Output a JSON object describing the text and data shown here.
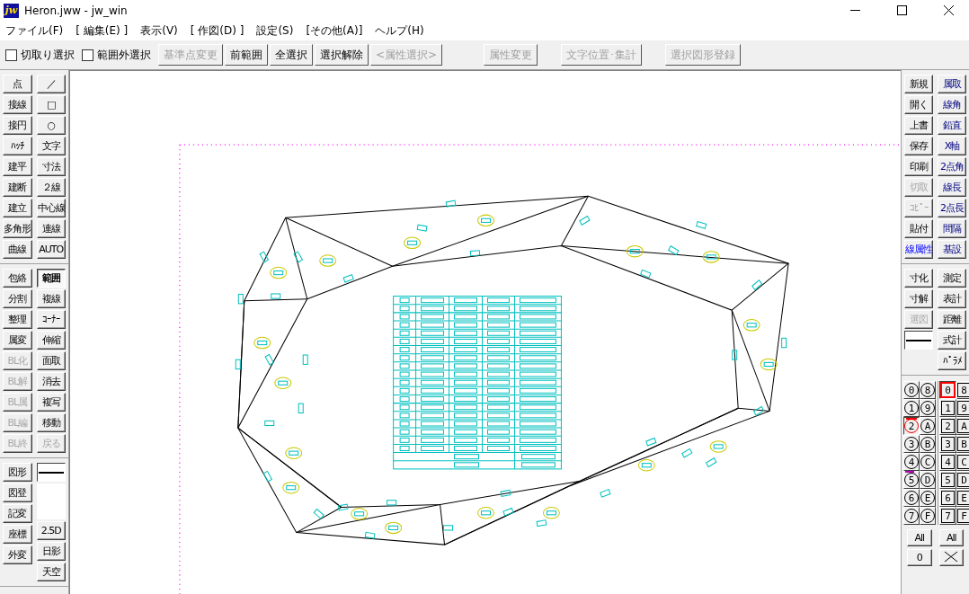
{
  "window": {
    "title": "Heron.jww - jw_win",
    "logo": "jw"
  },
  "menu": [
    "ファイル(F)",
    "[ 編集(E) ]",
    "表示(V)",
    "[ 作図(D) ]",
    "設定(S)",
    "[その他(A)]",
    "ヘルプ(H)"
  ],
  "toolbar": {
    "checkboxes": [
      {
        "label": "切取り選択",
        "checked": false
      },
      {
        "label": "範囲外選択",
        "checked": false
      }
    ],
    "buttons": [
      {
        "label": "基準点変更",
        "disabled": true
      },
      {
        "label": "前範囲",
        "disabled": false
      },
      {
        "label": "全選択",
        "disabled": false
      },
      {
        "label": "選択解除",
        "disabled": false
      },
      {
        "label": "<属性選択>",
        "disabled": true
      }
    ],
    "attribute_buttons": [
      {
        "label": "属性変更",
        "disabled": true
      },
      {
        "label": "文字位置･集計",
        "disabled": true
      },
      {
        "label": "選択図形登録",
        "disabled": true
      }
    ]
  },
  "left_panel": {
    "groups": [
      {
        "columns": [
          [
            {
              "label": "点",
              "disabled": false
            },
            {
              "label": "接線",
              "disabled": false
            },
            {
              "label": "接円",
              "disabled": false
            },
            {
              "label": "ﾊｯﾁ",
              "disabled": false
            },
            {
              "label": "建平",
              "disabled": false
            },
            {
              "label": "建断",
              "disabled": false
            },
            {
              "label": "建立",
              "disabled": false
            },
            {
              "label": "多角形",
              "disabled": false
            },
            {
              "label": "曲線",
              "disabled": false
            }
          ],
          [
            {
              "label": "／",
              "disabled": false
            },
            {
              "label": "□",
              "disabled": false
            },
            {
              "label": "○",
              "disabled": false
            },
            {
              "label": "文字",
              "disabled": false
            },
            {
              "label": "寸法",
              "disabled": false
            },
            {
              "label": "２線",
              "disabled": false
            },
            {
              "label": "中心線",
              "disabled": false
            },
            {
              "label": "連線",
              "disabled": false
            },
            {
              "label": "AUTO",
              "disabled": false
            }
          ]
        ]
      },
      {
        "columns": [
          [
            {
              "label": "包絡",
              "disabled": false
            },
            {
              "label": "分割",
              "disabled": false
            },
            {
              "label": "整理",
              "disabled": false
            },
            {
              "label": "属変",
              "disabled": false
            },
            {
              "label": "BL化",
              "disabled": true
            },
            {
              "label": "BL解",
              "disabled": true
            },
            {
              "label": "BL属",
              "disabled": true
            },
            {
              "label": "BL編",
              "disabled": true
            },
            {
              "label": "BL終",
              "disabled": true
            }
          ],
          [
            {
              "label": "範囲",
              "disabled": false,
              "pressed": true
            },
            {
              "label": "複線",
              "disabled": false,
              "pressed": false
            },
            {
              "label": "ｺｰﾅｰ",
              "disabled": false,
              "pressed": false
            },
            {
              "label": "伸縮",
              "disabled": false,
              "pressed": false
            },
            {
              "label": "面取",
              "disabled": false,
              "pressed": false
            },
            {
              "label": "消去",
              "disabled": false,
              "pressed": false
            },
            {
              "label": "複写",
              "disabled": false,
              "pressed": false
            },
            {
              "label": "移動",
              "disabled": false,
              "pressed": false
            },
            {
              "label": "戻る",
              "disabled": true,
              "pressed": false
            }
          ]
        ]
      },
      {
        "columns": [
          [
            {
              "label": "図形",
              "disabled": false
            },
            {
              "label": "図登",
              "disabled": false
            },
            {
              "label": "記変",
              "disabled": false
            },
            {
              "label": "座標",
              "disabled": false
            },
            {
              "label": "外変",
              "disabled": false
            }
          ],
          [
            {
              "kind": "line_sample"
            },
            {
              "kind": "blank"
            },
            {
              "kind": "button",
              "label": "2.5D",
              "disabled": false
            },
            {
              "kind": "button",
              "label": "日影",
              "disabled": false
            },
            {
              "kind": "button",
              "label": "天空",
              "disabled": false
            }
          ]
        ]
      }
    ]
  },
  "right_panel": {
    "groups": [
      {
        "columns": [
          [
            {
              "kind": "button",
              "label": "新規",
              "disabled": false
            },
            {
              "kind": "button",
              "label": "開く",
              "disabled": false
            },
            {
              "kind": "button",
              "label": "上書",
              "disabled": false
            },
            {
              "kind": "button",
              "label": "保存",
              "disabled": false
            },
            {
              "kind": "button",
              "label": "印刷",
              "disabled": false
            },
            {
              "kind": "button",
              "label": "切取",
              "disabled": true
            },
            {
              "kind": "button",
              "label": "ｺﾋﾟｰ",
              "disabled": true
            },
            {
              "kind": "button",
              "label": "貼付",
              "disabled": false
            },
            {
              "kind": "attribute_button",
              "label": "線属性",
              "disabled": false
            }
          ],
          [
            {
              "kind": "snap_button",
              "label": "属取",
              "disabled": false
            },
            {
              "kind": "snap_button",
              "label": "線角",
              "disabled": false
            },
            {
              "kind": "snap_button",
              "label": "鉛直",
              "disabled": false
            },
            {
              "kind": "snap_button",
              "label": "X軸",
              "disabled": false
            },
            {
              "kind": "snap_button",
              "label": "2点角",
              "disabled": false
            },
            {
              "kind": "snap_button",
              "label": "線長",
              "disabled": false
            },
            {
              "kind": "snap_button",
              "label": "2点長",
              "disabled": false
            },
            {
              "kind": "snap_button",
              "label": "間隔",
              "disabled": false
            },
            {
              "kind": "snap_button",
              "label": "基設",
              "disabled": false
            }
          ]
        ]
      },
      {
        "columns": [
          [
            {
              "kind": "button",
              "label": "寸化",
              "disabled": false
            },
            {
              "kind": "button",
              "label": "寸解",
              "disabled": false
            },
            {
              "kind": "button",
              "label": "選図",
              "disabled": true
            },
            {
              "kind": "line_sample"
            }
          ],
          [
            {
              "label": "測定",
              "disabled": false
            },
            {
              "label": "表計",
              "disabled": false
            },
            {
              "label": "距離",
              "disabled": false
            },
            {
              "label": "式計",
              "disabled": false
            },
            {
              "label": "ﾊﾟﾗﾒ",
              "disabled": false
            }
          ]
        ]
      }
    ]
  },
  "layers": [
    {
      "label": "0",
      "selected": false,
      "marked": false
    },
    {
      "label": "1",
      "selected": false,
      "marked": false
    },
    {
      "label": "2",
      "selected": true,
      "marked": false
    },
    {
      "label": "3",
      "selected": false,
      "marked": false
    },
    {
      "label": "4",
      "selected": false,
      "marked": false
    },
    {
      "label": "5",
      "selected": false,
      "marked": true
    },
    {
      "label": "6",
      "selected": false,
      "marked": false
    },
    {
      "label": "7",
      "selected": false,
      "marked": false
    },
    {
      "label": "8",
      "selected": false,
      "marked": false
    },
    {
      "label": "9",
      "selected": false,
      "marked": false
    },
    {
      "label": "A",
      "selected": false,
      "marked": false
    },
    {
      "label": "B",
      "selected": false,
      "marked": false
    },
    {
      "label": "C",
      "selected": false,
      "marked": false
    },
    {
      "label": "D",
      "selected": false,
      "marked": false
    },
    {
      "label": "E",
      "selected": false,
      "marked": false
    },
    {
      "label": "F",
      "selected": false,
      "marked": false
    }
  ],
  "layer_groups": [
    {
      "label": "0",
      "selected": true
    },
    {
      "label": "1",
      "selected": false
    },
    {
      "label": "2",
      "selected": false
    },
    {
      "label": "3",
      "selected": false
    },
    {
      "label": "4",
      "selected": false
    },
    {
      "label": "5",
      "selected": false
    },
    {
      "label": "6",
      "selected": false
    },
    {
      "label": "7",
      "selected": false
    },
    {
      "label": "8",
      "selected": false
    },
    {
      "label": "9",
      "selected": false
    },
    {
      "label": "A",
      "selected": false
    },
    {
      "label": "B",
      "selected": false
    },
    {
      "label": "C",
      "selected": false
    },
    {
      "label": "D",
      "selected": false
    },
    {
      "label": "E",
      "selected": false
    },
    {
      "label": "F",
      "selected": false
    }
  ],
  "all_buttons": [
    "All",
    "All"
  ],
  "zero_button": "0"
}
